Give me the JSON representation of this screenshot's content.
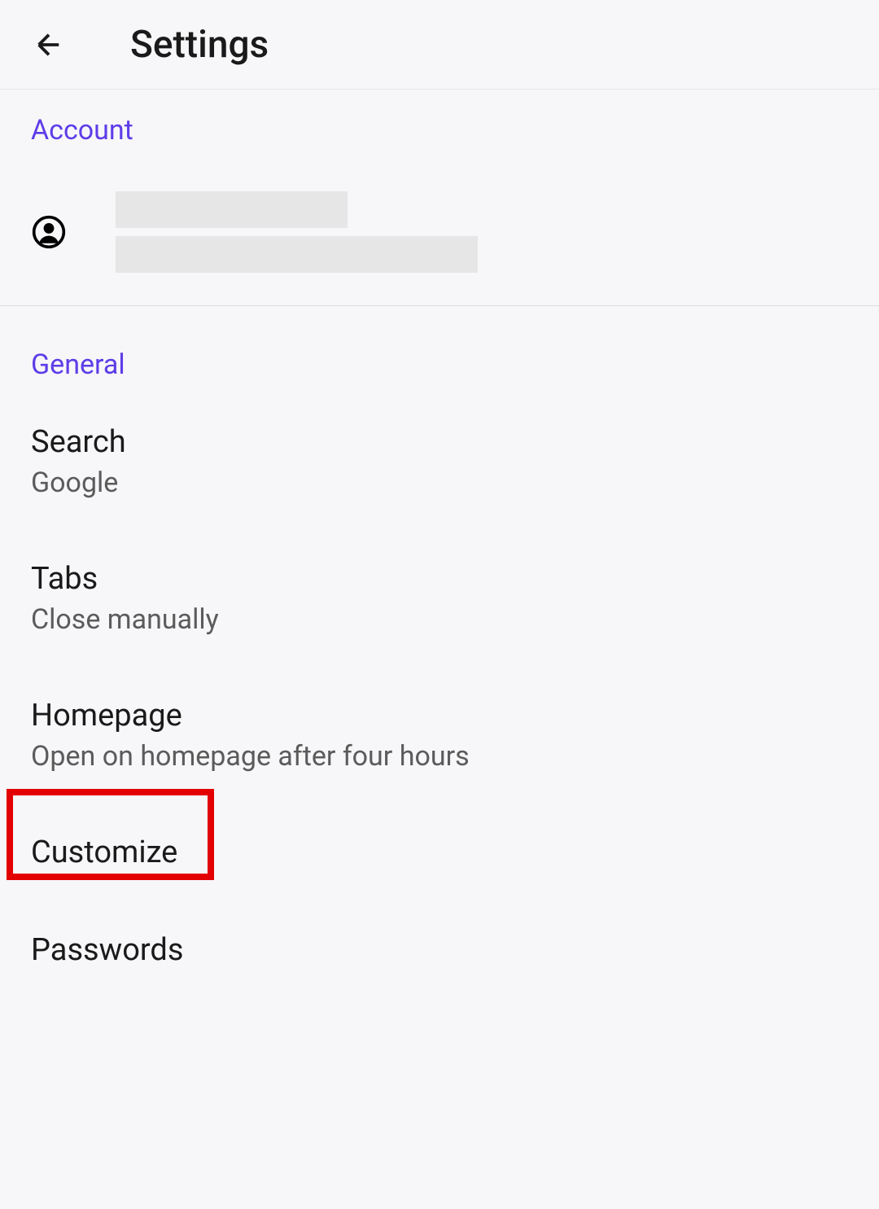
{
  "header": {
    "title": "Settings"
  },
  "sections": {
    "account": {
      "label": "Account"
    },
    "general": {
      "label": "General",
      "items": {
        "search": {
          "title": "Search",
          "subtitle": "Google"
        },
        "tabs": {
          "title": "Tabs",
          "subtitle": "Close manually"
        },
        "homepage": {
          "title": "Homepage",
          "subtitle": "Open on homepage after four hours"
        },
        "customize": {
          "title": "Customize"
        },
        "passwords": {
          "title": "Passwords"
        }
      }
    }
  }
}
